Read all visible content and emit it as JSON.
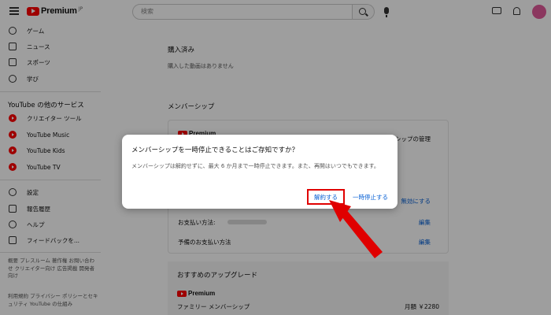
{
  "header": {
    "logo_text": "Premium",
    "logo_sup": "JP",
    "search_placeholder": "検索",
    "icons": [
      "menu-icon",
      "search-icon",
      "mic-icon",
      "create-icon",
      "bell-icon",
      "avatar"
    ]
  },
  "sidebar": {
    "top_items": [
      {
        "label": "ゲーム",
        "icon": "gamepad-icon"
      },
      {
        "label": "ニュース",
        "icon": "news-icon"
      },
      {
        "label": "スポーツ",
        "icon": "trophy-icon"
      },
      {
        "label": "学び",
        "icon": "lightbulb-icon"
      }
    ],
    "services_heading": "YouTube の他のサービス",
    "services": [
      {
        "label": "クリエイター ツール",
        "icon": "youtube-studio-icon"
      },
      {
        "label": "YouTube Music",
        "icon": "youtube-music-icon"
      },
      {
        "label": "YouTube Kids",
        "icon": "youtube-kids-icon"
      },
      {
        "label": "YouTube TV",
        "icon": "youtube-tv-icon"
      }
    ],
    "bottom_items": [
      {
        "label": "設定",
        "icon": "gear-icon"
      },
      {
        "label": "報告履歴",
        "icon": "flag-icon"
      },
      {
        "label": "ヘルプ",
        "icon": "help-icon"
      },
      {
        "label": "フィードバックを...",
        "icon": "feedback-icon"
      }
    ],
    "footer1": "概要 プレスルーム 著作権 お問い合わせ クリエイター向け 広告掲載 開発者向け",
    "footer2": "利用規約 プライバシー ポリシーとセキュリティ YouTube の仕組み"
  },
  "main": {
    "purchased_title": "購入済み",
    "purchased_empty": "購入した動画はありません",
    "membership_title": "メンバーシップ",
    "premium_label": "Premium",
    "manage_link": "シップの管理",
    "cancel_link": "無効にする",
    "payment_label": "お支払い方法:",
    "payment_edit": "編集",
    "backup_payment_label": "予備のお支払い方法",
    "backup_edit": "編集",
    "upgrade_title": "おすすめのアップグレード",
    "upgrade_premium": "Premium",
    "family_plan": "ファミリー メンバーシップ",
    "family_price": "月額 ￥2280"
  },
  "dialog": {
    "title": "メンバーシップを一時停止できることはご存知ですか？",
    "body": "メンバーシップは解約せずに、最大 6 か月まで一時停止できます。また、再開はいつでもできます。",
    "cancel_button": "解約する",
    "pause_button": "一時停止する"
  },
  "colors": {
    "accent_link": "#065fd4",
    "brand_red": "#ff0000",
    "highlight_red": "#e00000"
  }
}
